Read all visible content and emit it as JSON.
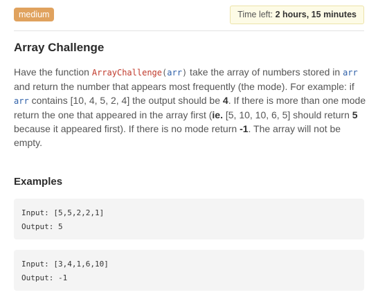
{
  "header": {
    "difficulty": "medium",
    "timer_label": "Time left:",
    "timer_value": "2 hours, 15 minutes"
  },
  "challenge": {
    "title": "Array Challenge",
    "desc": {
      "t1": "Have the function ",
      "fn": "ArrayChallenge",
      "paren_open": "(",
      "arg": "arr",
      "paren_close": ")",
      "t2": " take the array of numbers stored in ",
      "arr1": "arr",
      "t3": " and return the number that appears most frequently (the mode). For example: if ",
      "arr2": "arr",
      "t4": " contains [10, 4, 5, 2, 4] the output should be ",
      "b1": "4",
      "t5": ". If there is more than one mode return the one that appeared in the array first (",
      "b2": "ie.",
      "t6": " [5, 10, 10, 6, 5] should return ",
      "b3": "5",
      "t7": " because it appeared first). If there is no mode return ",
      "b4": "-1",
      "t8": ". The array will not be empty."
    }
  },
  "examples": {
    "title": "Examples",
    "items": [
      {
        "input": "Input: [5,5,2,2,1]",
        "output": "Output: 5"
      },
      {
        "input": "Input: [3,4,1,6,10]",
        "output": "Output: -1"
      }
    ]
  },
  "colors": {
    "badge": "#e0a25e",
    "timer_bg": "#fdfbe6",
    "function_name": "#c0392b",
    "arg_name": "#2d5fa8",
    "example_bg": "#f4f4f4"
  }
}
